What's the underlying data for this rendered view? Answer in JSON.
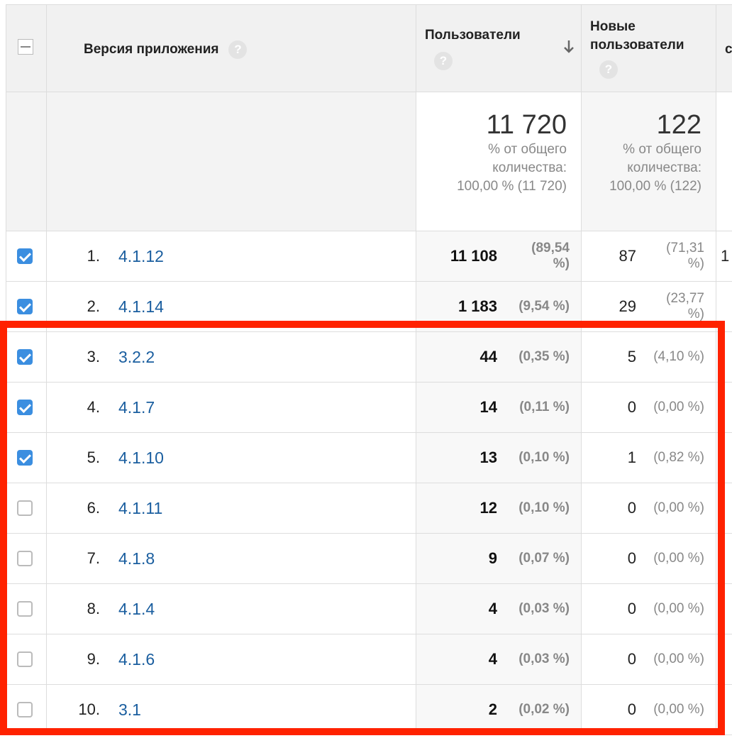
{
  "header": {
    "dimension_label": "Версия приложения",
    "col_users": "Пользователи",
    "col_new_users_1": "Новые",
    "col_new_users_2": "пользователи",
    "col_cut": "с",
    "sort_icon": "arrow-down-icon"
  },
  "totals": {
    "users": "11 720",
    "users_sub1": "% от общего",
    "users_sub2": "количества:",
    "users_sub3": "100,00 % (11 720)",
    "new_users": "122",
    "new_sub1": "% от общего",
    "new_sub2": "количества:",
    "new_sub3": "100,00 % (122)"
  },
  "rows": [
    {
      "rank": "1.",
      "version": "4.1.12",
      "users": "11 108",
      "users_pct": "(89,54 %)",
      "new": "87",
      "new_pct": "(71,31 %)",
      "checked": true,
      "cut": "1"
    },
    {
      "rank": "2.",
      "version": "4.1.14",
      "users": "1 183",
      "users_pct": "(9,54 %)",
      "new": "29",
      "new_pct": "(23,77 %)",
      "checked": true,
      "cut": ""
    },
    {
      "rank": "3.",
      "version": "3.2.2",
      "users": "44",
      "users_pct": "(0,35 %)",
      "new": "5",
      "new_pct": "(4,10 %)",
      "checked": true,
      "cut": ""
    },
    {
      "rank": "4.",
      "version": "4.1.7",
      "users": "14",
      "users_pct": "(0,11 %)",
      "new": "0",
      "new_pct": "(0,00 %)",
      "checked": true,
      "cut": ""
    },
    {
      "rank": "5.",
      "version": "4.1.10",
      "users": "13",
      "users_pct": "(0,10 %)",
      "new": "1",
      "new_pct": "(0,82 %)",
      "checked": true,
      "cut": ""
    },
    {
      "rank": "6.",
      "version": "4.1.11",
      "users": "12",
      "users_pct": "(0,10 %)",
      "new": "0",
      "new_pct": "(0,00 %)",
      "checked": false,
      "cut": ""
    },
    {
      "rank": "7.",
      "version": "4.1.8",
      "users": "9",
      "users_pct": "(0,07 %)",
      "new": "0",
      "new_pct": "(0,00 %)",
      "checked": false,
      "cut": ""
    },
    {
      "rank": "8.",
      "version": "4.1.4",
      "users": "4",
      "users_pct": "(0,03 %)",
      "new": "0",
      "new_pct": "(0,00 %)",
      "checked": false,
      "cut": ""
    },
    {
      "rank": "9.",
      "version": "4.1.6",
      "users": "4",
      "users_pct": "(0,03 %)",
      "new": "0",
      "new_pct": "(0,00 %)",
      "checked": false,
      "cut": ""
    },
    {
      "rank": "10.",
      "version": "3.1",
      "users": "2",
      "users_pct": "(0,02 %)",
      "new": "0",
      "new_pct": "(0,00 %)",
      "checked": false,
      "cut": ""
    }
  ],
  "colors": {
    "highlight": "#ff2200",
    "link": "#1a5e9f",
    "checkbox_on": "#3b8ee0"
  }
}
